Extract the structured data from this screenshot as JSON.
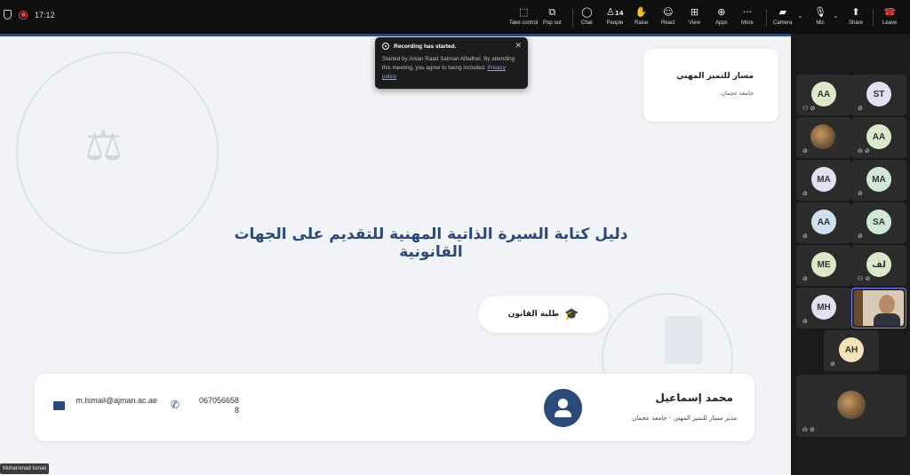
{
  "toolbar": {
    "time": "17:12",
    "buttons": [
      {
        "label": "Take control",
        "icon": "take-control-icon"
      },
      {
        "label": "Pop out",
        "icon": "pop-out-icon"
      },
      {
        "label": "Chat",
        "icon": "chat-icon"
      },
      {
        "label": "People",
        "icon": "people-icon",
        "count": "14"
      },
      {
        "label": "Raise",
        "icon": "raise-hand-icon"
      },
      {
        "label": "React",
        "icon": "react-icon"
      },
      {
        "label": "View",
        "icon": "view-icon"
      },
      {
        "label": "Apps",
        "icon": "apps-icon"
      },
      {
        "label": "More",
        "icon": "more-icon"
      },
      {
        "label": "Camera",
        "icon": "camera-off-icon"
      },
      {
        "label": "Mic",
        "icon": "mic-off-icon"
      },
      {
        "label": "Share",
        "icon": "share-icon"
      },
      {
        "label": "Leave",
        "icon": "leave-phone-icon"
      }
    ]
  },
  "toast": {
    "title": "Recording has started.",
    "body": "Started by Arkan Raad Salman Alfadhel. By attending this meeting, you agree to being included.",
    "link": "Privacy policy"
  },
  "slide": {
    "org_name": "مسار للتميز المهني",
    "org_sub": "جامعة عجمان",
    "title": "دليل كتابة السيرة الذاتية المهنية للتقديم على الجهات القانونية",
    "audience": "طلبة القانون",
    "contact": {
      "name": "محمد إسماعيل",
      "role": "مدير مسار للتميز المهني - جامعة عجمان",
      "phone": "0670566588",
      "email": "m.Ismail@ajman.ac.ae"
    }
  },
  "speaker_tag": "Mohammad Ismail",
  "participants": [
    {
      "initials": "AA",
      "color": "#dbe9c9"
    },
    {
      "initials": "ST",
      "color": "#e4dff2"
    },
    {
      "initials": "",
      "color": "photo"
    },
    {
      "initials": "AA",
      "color": "#dbe9c9"
    },
    {
      "initials": "MA",
      "color": "#e4dff2"
    },
    {
      "initials": "MA",
      "color": "#cfe8d6"
    },
    {
      "initials": "AA",
      "color": "#cfe0f3"
    },
    {
      "initials": "SA",
      "color": "#cfe8d6"
    },
    {
      "initials": "ME",
      "color": "#dbe9c9"
    },
    {
      "initials": "لف",
      "color": "#dbe9c9"
    },
    {
      "initials": "MH",
      "color": "#e4dff2"
    },
    {
      "initials": "",
      "color": "video"
    },
    {
      "initials": "AH",
      "color": "#f3e3b5"
    },
    {
      "initials": "",
      "color": "photo"
    }
  ]
}
